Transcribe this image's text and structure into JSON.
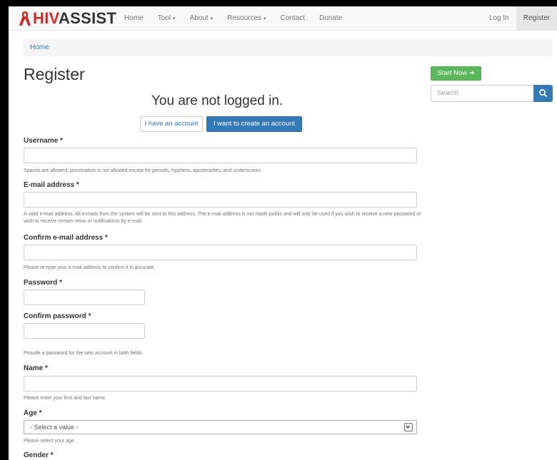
{
  "brand": {
    "part1": "HIV",
    "part2": "ASSIST",
    "ribbon_color": "#d42a27"
  },
  "nav": {
    "items": [
      {
        "label": "Home"
      },
      {
        "label": "Tool",
        "caret": "▾"
      },
      {
        "label": "About",
        "caret": "▾"
      },
      {
        "label": "Resources",
        "caret": "▾"
      },
      {
        "label": "Contact"
      },
      {
        "label": "Donate"
      }
    ],
    "right": [
      {
        "label": "Log In"
      },
      {
        "label": "Register",
        "active": true
      }
    ]
  },
  "breadcrumb": {
    "home": "Home"
  },
  "page": {
    "title": "Register",
    "not_logged_in": "You are not logged in.",
    "have_account_label": "I have an account",
    "create_account_label": "I want to create an account"
  },
  "form": {
    "username": {
      "label": "Username *",
      "value": "",
      "help": "Spaces are allowed; punctuation is not allowed except for periods, hyphens, apostrophes, and underscores."
    },
    "email": {
      "label": "E-mail address *",
      "value": "",
      "help": "A valid e-mail address. All e-mails from the system will be sent to this address. The e-mail address is not made public and will only be used if you wish to receive a new password or wish to receive certain news or notifications by e-mail."
    },
    "confirm_email": {
      "label": "Confirm e-mail address *",
      "value": "",
      "help": "Please re-type your e-mail address to confirm it is accurate."
    },
    "password": {
      "label": "Password *",
      "value": ""
    },
    "confirm_password": {
      "label": "Confirm password *",
      "value": "",
      "help": "Provide a password for the new account in both fields."
    },
    "name": {
      "label": "Name *",
      "value": "",
      "help": "Please enter your first and last name."
    },
    "age": {
      "label": "Age *",
      "selected": "- Select a value -",
      "help": "Please select your age."
    },
    "gender": {
      "label": "Gender *"
    }
  },
  "sidebar": {
    "start_now_label": "Start Now",
    "start_now_arrow": "➜",
    "start_now_color": "#5cb85c",
    "search_placeholder": "Search",
    "search_icon": "search-icon"
  },
  "colors": {
    "primary": "#337ab7",
    "brand_red": "#d42a27"
  }
}
